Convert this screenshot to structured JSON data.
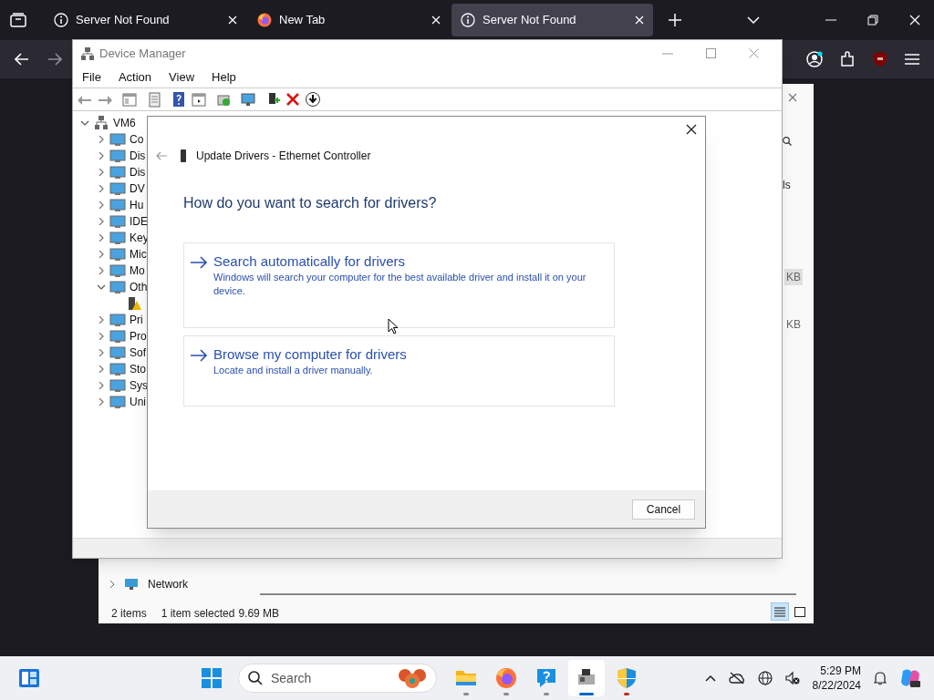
{
  "browser": {
    "tabs": [
      {
        "title": "Server Not Found",
        "kind": "info",
        "selected": false
      },
      {
        "title": "New Tab",
        "kind": "firefox",
        "selected": false
      },
      {
        "title": "Server Not Found",
        "kind": "info",
        "selected": true
      }
    ]
  },
  "explorer": {
    "fragments": [
      "ls",
      "KB",
      "KB"
    ],
    "nav_item": "Network",
    "status": [
      "2 items",
      "1 item selected",
      "9.69 MB"
    ],
    "views": [
      {
        "kind": "details",
        "selected": true
      },
      {
        "kind": "tiles",
        "selected": false
      }
    ]
  },
  "device_manager": {
    "title": "Device Manager",
    "menu": [
      "File",
      "Action",
      "View",
      "Help"
    ],
    "tree": {
      "label": "VM6",
      "expanded": true,
      "children": [
        {
          "label": "Co",
          "kind": "category",
          "expanded": false
        },
        {
          "label": "Dis",
          "kind": "category",
          "expanded": false
        },
        {
          "label": "Dis",
          "kind": "category",
          "expanded": false
        },
        {
          "label": "DV",
          "kind": "category",
          "expanded": false
        },
        {
          "label": "Hu",
          "kind": "category",
          "expanded": false
        },
        {
          "label": "IDE",
          "kind": "category",
          "expanded": false
        },
        {
          "label": "Key",
          "kind": "category",
          "expanded": false
        },
        {
          "label": "Mic",
          "kind": "category",
          "expanded": false
        },
        {
          "label": "Mo",
          "kind": "category",
          "expanded": false
        },
        {
          "label": "Oth",
          "kind": "category",
          "expanded": true,
          "children": [
            {
              "kind": "device"
            }
          ]
        },
        {
          "label": "Pri",
          "kind": "category",
          "expanded": false
        },
        {
          "label": "Pro",
          "kind": "category",
          "expanded": false
        },
        {
          "label": "Sof",
          "kind": "category",
          "expanded": false
        },
        {
          "label": "Sto",
          "kind": "category",
          "expanded": false
        },
        {
          "label": "Sys",
          "kind": "category",
          "expanded": false
        },
        {
          "label": "Uni",
          "kind": "category",
          "expanded": false
        }
      ]
    }
  },
  "dialog": {
    "title": "Update Drivers - Ethernet Controller",
    "heading": "How do you want to search for drivers?",
    "options": [
      {
        "title": "Search automatically for drivers",
        "description": "Windows will search your computer for the best available driver and install it on your device."
      },
      {
        "title": "Browse my computer for drivers",
        "description": "Locate and install a driver manually."
      }
    ],
    "buttons": [
      "Cancel"
    ]
  },
  "taskbar": {
    "search": {
      "placeholder": "Search"
    },
    "apps": [
      {
        "kind": "folder",
        "selected": false,
        "color": "#8a8a8a"
      },
      {
        "kind": "firefox",
        "selected": false,
        "color": "#8a8a8a"
      },
      {
        "kind": "help",
        "selected": false,
        "color": "#8a8a8a"
      },
      {
        "kind": "devmgr",
        "selected": true,
        "color": "#0067c0"
      },
      {
        "kind": "shield",
        "selected": false,
        "color": "#c42b1c"
      }
    ],
    "time": "5:29 PM",
    "date": "8/22/2024"
  }
}
